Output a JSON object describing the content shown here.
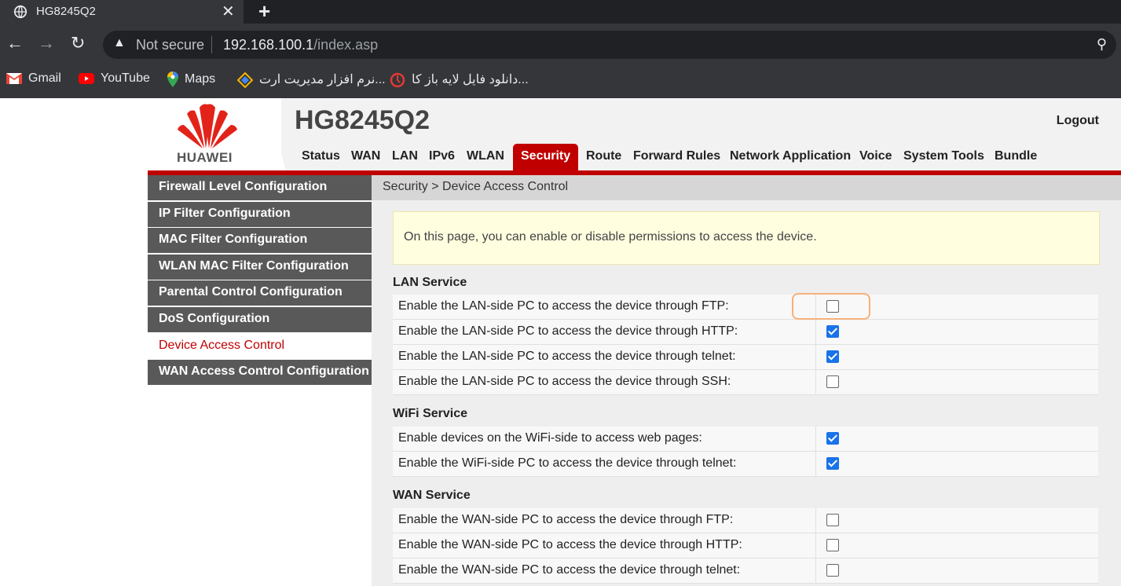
{
  "browser": {
    "tab_title": "HG8245Q2",
    "tab_close": "✕",
    "new_tab": "+",
    "security_label": "Not secure",
    "url_host": "192.168.100.1",
    "url_path": "/index.asp",
    "bookmarks": [
      {
        "label": "Gmail",
        "icon": "gmail-icon"
      },
      {
        "label": "YouTube",
        "icon": "youtube-icon"
      },
      {
        "label": "Maps",
        "icon": "maps-icon"
      },
      {
        "label": "نرم افزار مدیریت ارت...",
        "icon": "bookmark-diamond-icon"
      },
      {
        "label": "دانلود فایل لایه باز کا...",
        "icon": "bookmark-red-icon"
      }
    ]
  },
  "router": {
    "brand": "HUAWEI",
    "model": "HG8245Q2",
    "logout": "Logout",
    "menu": [
      "Status",
      "WAN",
      "LAN",
      "IPv6",
      "WLAN",
      "Security",
      "Route",
      "Forward Rules",
      "Network Application",
      "Voice",
      "System Tools",
      "Bundle"
    ],
    "active_menu": "Security",
    "sidebar": [
      "Firewall Level Configuration",
      "IP Filter Configuration",
      "MAC Filter Configuration",
      "WLAN MAC Filter Configuration",
      "Parental Control Configuration",
      "DoS Configuration",
      "Device Access Control",
      "WAN Access Control Configuration"
    ],
    "active_sidebar": "Device Access Control",
    "breadcrumb": "Security > Device Access Control",
    "notice": "On this page, you can enable or disable permissions to access the device.",
    "sections": [
      {
        "title": "LAN Service",
        "rows": [
          {
            "label": "Enable the LAN-side PC to access the device through FTP:",
            "checked": false
          },
          {
            "label": "Enable the LAN-side PC to access the device through HTTP:",
            "checked": true
          },
          {
            "label": "Enable the LAN-side PC to access the device through telnet:",
            "checked": true
          },
          {
            "label": "Enable the LAN-side PC to access the device through SSH:",
            "checked": false
          }
        ]
      },
      {
        "title": "WiFi Service",
        "rows": [
          {
            "label": "Enable devices on the WiFi-side to access web pages:",
            "checked": true
          },
          {
            "label": "Enable the WiFi-side PC to access the device through telnet:",
            "checked": true
          }
        ]
      },
      {
        "title": "WAN Service",
        "rows": [
          {
            "label": "Enable the WAN-side PC to access the device through FTP:",
            "checked": false
          },
          {
            "label": "Enable the WAN-side PC to access the device through HTTP:",
            "checked": false
          },
          {
            "label": "Enable the WAN-side PC to access the device through telnet:",
            "checked": false
          }
        ]
      }
    ]
  },
  "colors": {
    "brand_red": "#c00000",
    "sidebar_gray": "#595959",
    "checkbox_blue": "#1a73e8"
  }
}
